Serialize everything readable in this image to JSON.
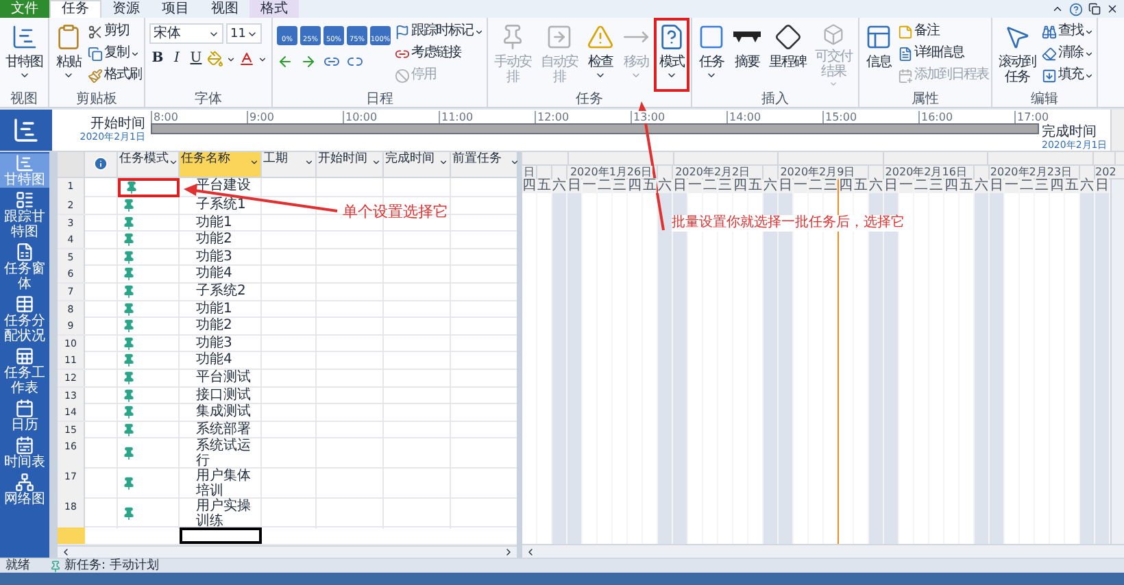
{
  "ribbon": {
    "tabs": [
      {
        "label": "文件",
        "kind": "file",
        "selected": false
      },
      {
        "label": "任务",
        "kind": "normal",
        "selected": true
      },
      {
        "label": "资源",
        "kind": "normal",
        "selected": false
      },
      {
        "label": "项目",
        "kind": "normal",
        "selected": false
      },
      {
        "label": "视图",
        "kind": "normal",
        "selected": false
      },
      {
        "label": "格式",
        "kind": "context",
        "selected": false
      }
    ],
    "groups": [
      {
        "label": "视图",
        "kind": "buttons",
        "buttons": [
          {
            "label": "甘特图",
            "kind": "large",
            "dropdown": true,
            "disabled": false,
            "highlighted": false
          }
        ]
      },
      {
        "label": "剪贴板",
        "kind": "buttons",
        "buttons": [
          {
            "label": "粘贴",
            "kind": "large",
            "dropdown": true,
            "disabled": false,
            "highlighted": false
          },
          {
            "label": "剪切",
            "kind": "small",
            "dropdown": false,
            "disabled": false,
            "highlighted": false
          },
          {
            "label": "复制",
            "kind": "small",
            "dropdown": true,
            "disabled": false,
            "highlighted": false
          },
          {
            "label": "格式刷",
            "kind": "small",
            "dropdown": false,
            "disabled": false,
            "highlighted": false
          }
        ]
      },
      {
        "label": "字体",
        "kind": "font",
        "font": "宋体",
        "size": "11",
        "format_buttons": [
          "B",
          "I",
          "U"
        ]
      },
      {
        "label": "日程",
        "kind": "schedule",
        "percent_buttons": [
          "0%",
          "25%",
          "50%",
          "75%",
          "100%"
        ],
        "buttons": [
          {
            "label": "跟踪时标记",
            "kind": "small",
            "dropdown": true,
            "disabled": false,
            "highlighted": false
          },
          {
            "label": "考虑链接",
            "kind": "small",
            "dropdown": false,
            "disabled": false,
            "highlighted": false
          },
          {
            "label": "停用",
            "kind": "small",
            "dropdown": false,
            "disabled": true,
            "highlighted": false
          }
        ]
      },
      {
        "label": "任务",
        "kind": "buttons",
        "buttons": [
          {
            "label": "手动安排",
            "kind": "large",
            "dropdown": false,
            "disabled": true,
            "highlighted": false
          },
          {
            "label": "自动安排",
            "kind": "large",
            "dropdown": false,
            "disabled": true,
            "highlighted": false
          },
          {
            "label": "检查",
            "kind": "large",
            "dropdown": true,
            "disabled": false,
            "highlighted": false
          },
          {
            "label": "移动",
            "kind": "large",
            "dropdown": true,
            "disabled": true,
            "highlighted": false
          },
          {
            "label": "模式",
            "kind": "large",
            "dropdown": true,
            "disabled": false,
            "highlighted": true
          }
        ]
      },
      {
        "label": "插入",
        "kind": "buttons",
        "buttons": [
          {
            "label": "任务",
            "kind": "large",
            "dropdown": true,
            "disabled": false,
            "highlighted": false
          },
          {
            "label": "摘要",
            "kind": "large",
            "dropdown": false,
            "disabled": false,
            "highlighted": false
          },
          {
            "label": "里程碑",
            "kind": "large",
            "dropdown": false,
            "disabled": false,
            "highlighted": false
          },
          {
            "label": "可交付结果",
            "kind": "large",
            "dropdown": true,
            "disabled": true,
            "highlighted": false
          }
        ]
      },
      {
        "label": "属性",
        "kind": "buttons",
        "buttons": [
          {
            "label": "信息",
            "kind": "large",
            "dropdown": false,
            "disabled": false,
            "highlighted": false
          },
          {
            "label": "备注",
            "kind": "small",
            "dropdown": false,
            "disabled": false,
            "highlighted": false
          },
          {
            "label": "详细信息",
            "kind": "small",
            "dropdown": false,
            "disabled": false,
            "highlighted": false
          },
          {
            "label": "添加到日程表",
            "kind": "small",
            "dropdown": false,
            "disabled": true,
            "highlighted": false
          }
        ]
      },
      {
        "label": "编辑",
        "kind": "buttons",
        "buttons": [
          {
            "label": "滚动到任务",
            "kind": "large",
            "dropdown": false,
            "disabled": false,
            "highlighted": false
          },
          {
            "label": "查找",
            "kind": "small",
            "dropdown": true,
            "disabled": false,
            "highlighted": false
          },
          {
            "label": "清除",
            "kind": "small",
            "dropdown": true,
            "disabled": false,
            "highlighted": false
          },
          {
            "label": "填充",
            "kind": "small",
            "dropdown": true,
            "disabled": false,
            "highlighted": false
          }
        ]
      }
    ]
  },
  "timeline": {
    "start_label": "开始时间",
    "start_date": "2020年2月1日",
    "ticks": [
      "8:00",
      "9:00",
      "10:00",
      "11:00",
      "12:00",
      "13:00",
      "14:00",
      "15:00",
      "16:00",
      "17:00"
    ],
    "end_label": "完成时间",
    "end_date": "2020年2月1日"
  },
  "sidebar": {
    "items": [
      {
        "label": "甘特图",
        "selected": true
      },
      {
        "label": "跟踪甘特图",
        "selected": false
      },
      {
        "label": "任务窗体",
        "selected": false
      },
      {
        "label": "任务分配状况",
        "selected": false
      },
      {
        "label": "任务工作表",
        "selected": false
      },
      {
        "label": "日历",
        "selected": false
      },
      {
        "label": "时间表",
        "selected": false
      },
      {
        "label": "网络图",
        "selected": false
      }
    ]
  },
  "table": {
    "columns": [
      {
        "label": "任务模式",
        "selected": false
      },
      {
        "label": "任务名称",
        "selected": true
      },
      {
        "label": "工期",
        "selected": false
      },
      {
        "label": "开始时间",
        "selected": false
      },
      {
        "label": "完成时间",
        "selected": false
      },
      {
        "label": "前置任务",
        "selected": false
      }
    ],
    "rows": [
      {
        "num": "1",
        "name": "平台建设",
        "highlighted": true
      },
      {
        "num": "2",
        "name": "子系统1",
        "highlighted": false
      },
      {
        "num": "3",
        "name": "功能1",
        "highlighted": false
      },
      {
        "num": "4",
        "name": "功能2",
        "highlighted": false
      },
      {
        "num": "5",
        "name": "功能3",
        "highlighted": false
      },
      {
        "num": "6",
        "name": "功能4",
        "highlighted": false
      },
      {
        "num": "7",
        "name": "子系统2",
        "highlighted": false
      },
      {
        "num": "8",
        "name": "功能1",
        "highlighted": false
      },
      {
        "num": "9",
        "name": "功能2",
        "highlighted": false
      },
      {
        "num": "10",
        "name": "功能3",
        "highlighted": false
      },
      {
        "num": "11",
        "name": "功能4",
        "highlighted": false
      },
      {
        "num": "12",
        "name": "平台测试",
        "highlighted": false
      },
      {
        "num": "13",
        "name": "接口测试",
        "highlighted": false
      },
      {
        "num": "14",
        "name": "集成测试",
        "highlighted": false
      },
      {
        "num": "15",
        "name": "系统部署",
        "highlighted": false
      },
      {
        "num": "16",
        "name": "系统试运行",
        "highlighted": false
      },
      {
        "num": "17",
        "name": "用户集体培训",
        "highlighted": false
      },
      {
        "num": "18",
        "name": "用户实操训练",
        "highlighted": false
      }
    ],
    "blank_row": {
      "selected": true
    }
  },
  "gantt": {
    "weeks": [
      {
        "label": "日",
        "days": [
          {
            "label": "四",
            "weekend": false,
            "today": false
          },
          {
            "label": "五",
            "weekend": false,
            "today": false
          },
          {
            "label": "六",
            "weekend": true,
            "today": false
          }
        ]
      },
      {
        "label": "2020年1月26日",
        "days": [
          {
            "label": "日",
            "weekend": true,
            "today": false
          },
          {
            "label": "一",
            "weekend": false,
            "today": false
          },
          {
            "label": "二",
            "weekend": false,
            "today": false
          },
          {
            "label": "三",
            "weekend": false,
            "today": false
          },
          {
            "label": "四",
            "weekend": false,
            "today": false
          },
          {
            "label": "五",
            "weekend": false,
            "today": false
          },
          {
            "label": "六",
            "weekend": true,
            "today": false
          }
        ]
      },
      {
        "label": "2020年2月2日",
        "days": [
          {
            "label": "日",
            "weekend": true,
            "today": false
          },
          {
            "label": "一",
            "weekend": false,
            "today": false
          },
          {
            "label": "二",
            "weekend": false,
            "today": false
          },
          {
            "label": "三",
            "weekend": false,
            "today": false
          },
          {
            "label": "四",
            "weekend": false,
            "today": false
          },
          {
            "label": "五",
            "weekend": false,
            "today": false
          },
          {
            "label": "六",
            "weekend": true,
            "today": false
          }
        ]
      },
      {
        "label": "2020年2月9日",
        "days": [
          {
            "label": "日",
            "weekend": true,
            "today": false
          },
          {
            "label": "一",
            "weekend": false,
            "today": false
          },
          {
            "label": "二",
            "weekend": false,
            "today": false
          },
          {
            "label": "三",
            "weekend": false,
            "today": true
          },
          {
            "label": "四",
            "weekend": false,
            "today": false
          },
          {
            "label": "五",
            "weekend": false,
            "today": false
          },
          {
            "label": "六",
            "weekend": true,
            "today": false
          }
        ]
      },
      {
        "label": "2020年2月16日",
        "days": [
          {
            "label": "日",
            "weekend": true,
            "today": false
          },
          {
            "label": "一",
            "weekend": false,
            "today": false
          },
          {
            "label": "二",
            "weekend": false,
            "today": false
          },
          {
            "label": "三",
            "weekend": false,
            "today": false
          },
          {
            "label": "四",
            "weekend": false,
            "today": false
          },
          {
            "label": "五",
            "weekend": false,
            "today": false
          },
          {
            "label": "六",
            "weekend": true,
            "today": false
          }
        ]
      },
      {
        "label": "2020年2月23日",
        "days": [
          {
            "label": "日",
            "weekend": true,
            "today": false
          },
          {
            "label": "一",
            "weekend": false,
            "today": false
          },
          {
            "label": "二",
            "weekend": false,
            "today": false
          },
          {
            "label": "三",
            "weekend": false,
            "today": false
          },
          {
            "label": "四",
            "weekend": false,
            "today": false
          },
          {
            "label": "五",
            "weekend": false,
            "today": false
          },
          {
            "label": "六",
            "weekend": true,
            "today": false
          }
        ]
      },
      {
        "label": "202",
        "days": [
          {
            "label": "日",
            "weekend": true,
            "today": false
          }
        ]
      }
    ]
  },
  "annotations": [
    {
      "text": "单个设置选择它"
    },
    {
      "text": "批量设置你就选择一批任务后，选择它"
    }
  ],
  "status_bar": {
    "ready": "就绪",
    "new_task": "新任务: 手动计划"
  }
}
